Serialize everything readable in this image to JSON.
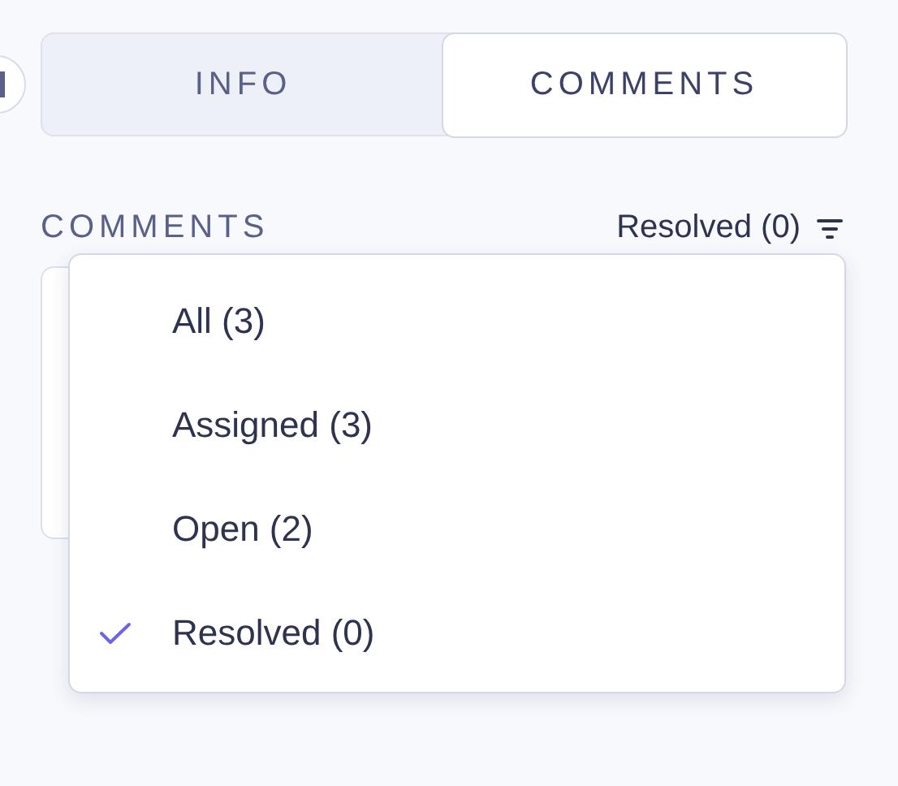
{
  "tabs": [
    {
      "label": "INFO",
      "selected": false
    },
    {
      "label": "COMMENTS",
      "selected": true
    }
  ],
  "section": {
    "title": "COMMENTS",
    "filter_label": "Resolved (0)"
  },
  "filter_menu": [
    {
      "label": "All (3)",
      "selected": false
    },
    {
      "label": "Assigned (3)",
      "selected": false
    },
    {
      "label": "Open (2)",
      "selected": false
    },
    {
      "label": "Resolved (0)",
      "selected": true
    }
  ]
}
